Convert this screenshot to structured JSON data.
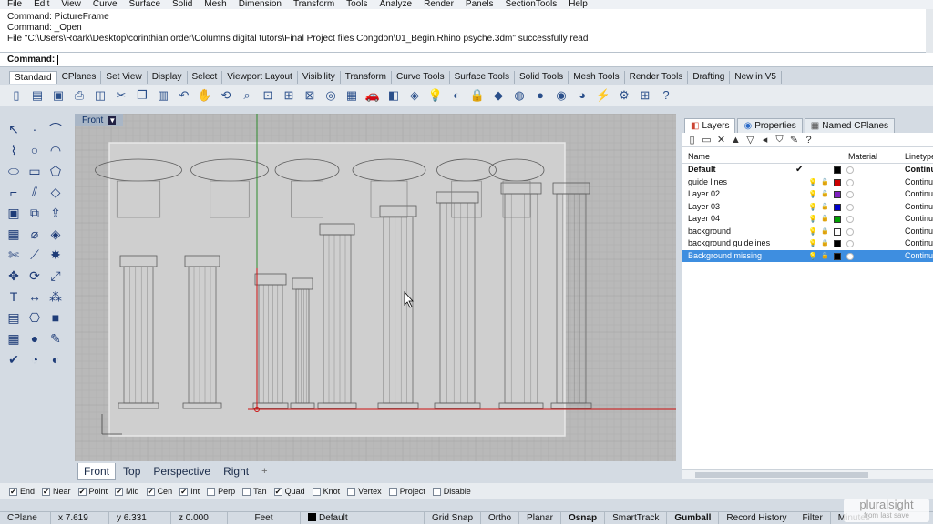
{
  "menu": [
    "File",
    "Edit",
    "View",
    "Curve",
    "Surface",
    "Solid",
    "Mesh",
    "Dimension",
    "Transform",
    "Tools",
    "Analyze",
    "Render",
    "Panels",
    "SectionTools",
    "Help"
  ],
  "history": [
    "Command: PictureFrame",
    "Command: _Open",
    "File \"C:\\Users\\Roark\\Desktop\\corinthian order\\Columns digital tutors\\Final Project files Congdon\\01_Begin.Rhino psyche.3dm\" successfully read"
  ],
  "command": {
    "label": "Command:",
    "value": ""
  },
  "toolbar_tabs": [
    "Standard",
    "CPlanes",
    "Set View",
    "Display",
    "Select",
    "Viewport Layout",
    "Visibility",
    "Transform",
    "Curve Tools",
    "Surface Tools",
    "Solid Tools",
    "Mesh Tools",
    "Render Tools",
    "Drafting",
    "New in V5"
  ],
  "toolbar_icons": [
    "new-icon",
    "open-icon",
    "save-icon",
    "print-icon",
    "import-icon",
    "cut-icon",
    "copy-icon",
    "paste-icon",
    "undo-icon",
    "pan-icon",
    "rotate-icon",
    "zoom-icon",
    "zoom-window-icon",
    "zoom-extents-icon",
    "zoom-selected-icon",
    "zoom-target-icon",
    "four-viewports-icon",
    "car-icon",
    "layer-icon",
    "object-properties-icon",
    "light-icon",
    "render-icon",
    "lock-icon",
    "material-icon",
    "color-icon",
    "sphere-icon",
    "render-preview-icon",
    "environment-icon",
    "flash-icon",
    "settings-icon",
    "grid-icon",
    "help-icon"
  ],
  "left_tools": [
    "select-icon",
    "point-icon",
    "polyline-icon",
    "curve-icon",
    "circle-icon",
    "arc-icon",
    "ellipse-icon",
    "rectangle-icon",
    "polygon-icon",
    "fillet-icon",
    "offset-icon",
    "surface-icon",
    "box-icon",
    "boolean-icon",
    "extrude-icon",
    "mesh-icon",
    "pipe-icon",
    "patch-icon",
    "trim-icon",
    "split-icon",
    "explode-icon",
    "move-icon",
    "rotate-icon",
    "scale-icon",
    "text-icon",
    "dimension-icon",
    "array-icon",
    "group-icon",
    "block-icon",
    "cube-icon",
    "grid-snap-icon",
    "sphere-icon",
    "paint-icon",
    "check-icon",
    "analyze-icon",
    "render-icon"
  ],
  "viewport": {
    "title": "Front"
  },
  "viewport_tabs": [
    "Front",
    "Top",
    "Perspective",
    "Right"
  ],
  "panel": {
    "tabs": [
      "Layers",
      "Properties",
      "Named CPlanes"
    ],
    "columns": {
      "name": "Name",
      "material": "Material",
      "linetype": "Linetype"
    },
    "layers": [
      {
        "name": "Default",
        "current": true,
        "color": "#000000",
        "linetype": "Continu",
        "locked": false,
        "selected": false
      },
      {
        "name": "guide lines",
        "current": false,
        "color": "#cc0000",
        "linetype": "Continuo",
        "locked": false,
        "selected": false
      },
      {
        "name": "Layer 02",
        "current": false,
        "color": "#8020c0",
        "linetype": "Continuo",
        "locked": false,
        "selected": false
      },
      {
        "name": "Layer 03",
        "current": false,
        "color": "#0000cc",
        "linetype": "Continuo",
        "locked": false,
        "selected": false
      },
      {
        "name": "Layer 04",
        "current": false,
        "color": "#00a000",
        "linetype": "Continuo",
        "locked": false,
        "selected": false
      },
      {
        "name": "background",
        "current": false,
        "color": "#ffffff",
        "linetype": "Continuo",
        "locked": true,
        "selected": false
      },
      {
        "name": "background guidelines",
        "current": false,
        "color": "#000000",
        "linetype": "Continuo",
        "locked": true,
        "selected": false
      },
      {
        "name": "Background missing",
        "current": false,
        "color": "#000000",
        "linetype": "Continuo",
        "locked": false,
        "selected": true
      }
    ]
  },
  "osnaps": [
    {
      "label": "End",
      "checked": true
    },
    {
      "label": "Near",
      "checked": true
    },
    {
      "label": "Point",
      "checked": true
    },
    {
      "label": "Mid",
      "checked": true
    },
    {
      "label": "Cen",
      "checked": true
    },
    {
      "label": "Int",
      "checked": true
    },
    {
      "label": "Perp",
      "checked": false
    },
    {
      "label": "Tan",
      "checked": false
    },
    {
      "label": "Quad",
      "checked": true
    },
    {
      "label": "Knot",
      "checked": false
    },
    {
      "label": "Vertex",
      "checked": false
    },
    {
      "label": "Project",
      "checked": false
    },
    {
      "label": "Disable",
      "checked": false
    }
  ],
  "status": {
    "cplane": "CPlane",
    "x": "x 7.619",
    "y": "y 6.331",
    "z": "z 0.000",
    "units": "Feet",
    "layer": "Default",
    "grid_snap": "Grid Snap",
    "ortho": "Ortho",
    "planar": "Planar",
    "osnap": "Osnap",
    "smarttrack": "SmartTrack",
    "gumball": "Gumball",
    "record_history": "Record History",
    "filter": "Filter",
    "minutes": "Minutes"
  },
  "watermark": {
    "brand": "pluralsight",
    "sub": "from last save"
  }
}
